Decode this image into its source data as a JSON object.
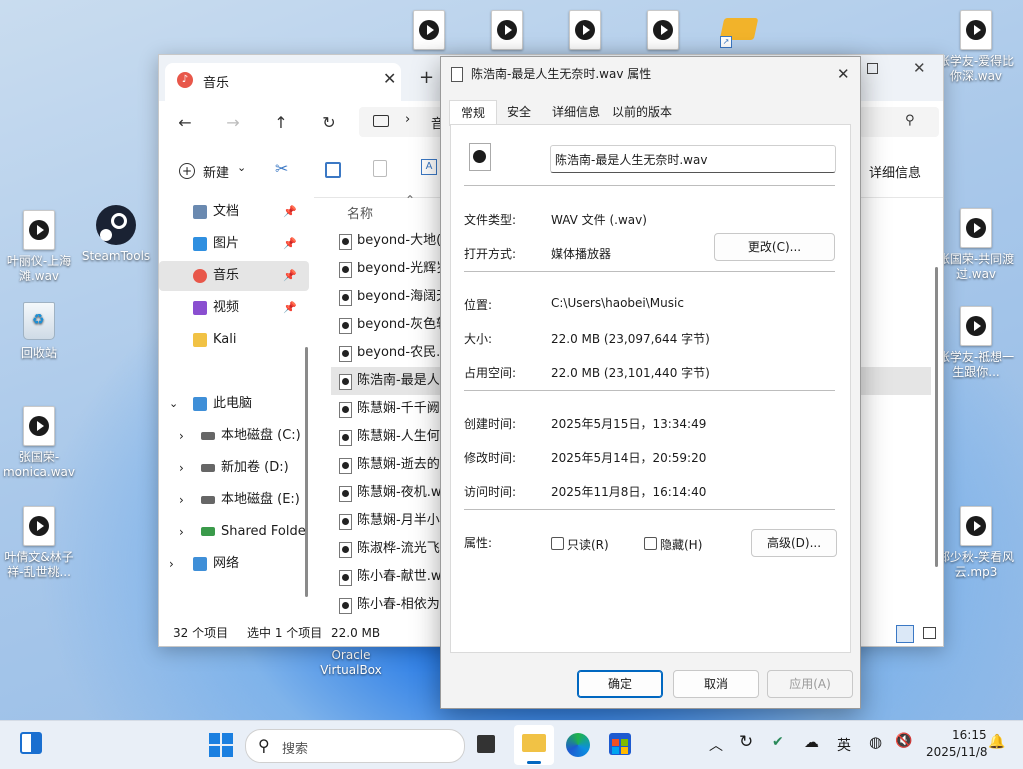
{
  "desktop": {
    "left_icons": [
      {
        "label": "叶丽仪-上海滩.wav"
      },
      {
        "label": "SteamTools"
      },
      {
        "label": "回收站"
      },
      {
        "label": "张国荣-monica.wav"
      },
      {
        "label": "叶倩文&林子祥-乱世桃..."
      }
    ],
    "right_icons": [
      {
        "label": "张学友-爱得比你深.wav"
      },
      {
        "label": "张国荣-共同渡过.wav"
      },
      {
        "label": "张学友-祗想一生跟你..."
      },
      {
        "label": "郑少秋-笑看风云.mp3"
      }
    ],
    "center_icon_label": "Oracle VirtualBox"
  },
  "explorer": {
    "tab_title": "音乐",
    "address_text": "音",
    "new_label": "新建",
    "details_label": "详细信息",
    "column_name": "名称",
    "sidebar": [
      {
        "label": "文档"
      },
      {
        "label": "图片"
      },
      {
        "label": "音乐"
      },
      {
        "label": "视频"
      },
      {
        "label": "Kali"
      },
      {
        "label": "此电脑"
      },
      {
        "label": "本地磁盘 (C:)"
      },
      {
        "label": "新加卷 (D:)"
      },
      {
        "label": "本地磁盘 (E:)"
      },
      {
        "label": "Shared Folde"
      },
      {
        "label": "网络"
      }
    ],
    "files": [
      "beyond-大地(粤",
      "beyond-光辉岁",
      "beyond-海阔天",
      "beyond-灰色轨",
      "beyond-农民.w",
      "陈浩南-最是人生",
      "陈慧娴-千千阙歌",
      "陈慧娴-人生何处",
      "陈慧娴-逝去的诺",
      "陈慧娴-夜机.wa",
      "陈慧娴-月半小夜",
      "陈淑桦-流光飞舞",
      "陈小春-献世.wa",
      "陈小春-相依为命"
    ],
    "status": {
      "count": "32 个项目",
      "selected": "选中 1 个项目",
      "size": "22.0 MB"
    }
  },
  "dialog": {
    "title": "陈浩南-最是人生无奈时.wav 属性",
    "tabs": [
      "常规",
      "安全",
      "详细信息",
      "以前的版本"
    ],
    "filename": "陈浩南-最是人生无奈时.wav",
    "file_type_label": "文件类型:",
    "file_type_value": "WAV 文件 (.wav)",
    "open_with_label": "打开方式:",
    "open_with_value": "媒体播放器",
    "change_button": "更改(C)...",
    "location_label": "位置:",
    "location_value": "C:\\Users\\haobei\\Music",
    "size_label": "大小:",
    "size_value": "22.0 MB (23,097,644 字节)",
    "disk_size_label": "占用空间:",
    "disk_size_value": "22.0 MB (23,101,440 字节)",
    "created_label": "创建时间:",
    "created_value": "2025年5月15日，13:34:49",
    "modified_label": "修改时间:",
    "modified_value": "2025年5月14日，20:59:20",
    "accessed_label": "访问时间:",
    "accessed_value": "2025年11月8日，16:14:40",
    "attributes_label": "属性:",
    "readonly_label": "只读(R)",
    "hidden_label": "隐藏(H)",
    "advanced_button": "高级(D)...",
    "ok_button": "确定",
    "cancel_button": "取消",
    "apply_button": "应用(A)"
  },
  "taskbar": {
    "search_label": "搜索",
    "ime_label": "英",
    "time": "16:15",
    "date": "2025/11/8"
  },
  "colors": {
    "accent": "#0067c0",
    "selection": "#e5e5e5",
    "taskbar": "#e9eff7"
  }
}
